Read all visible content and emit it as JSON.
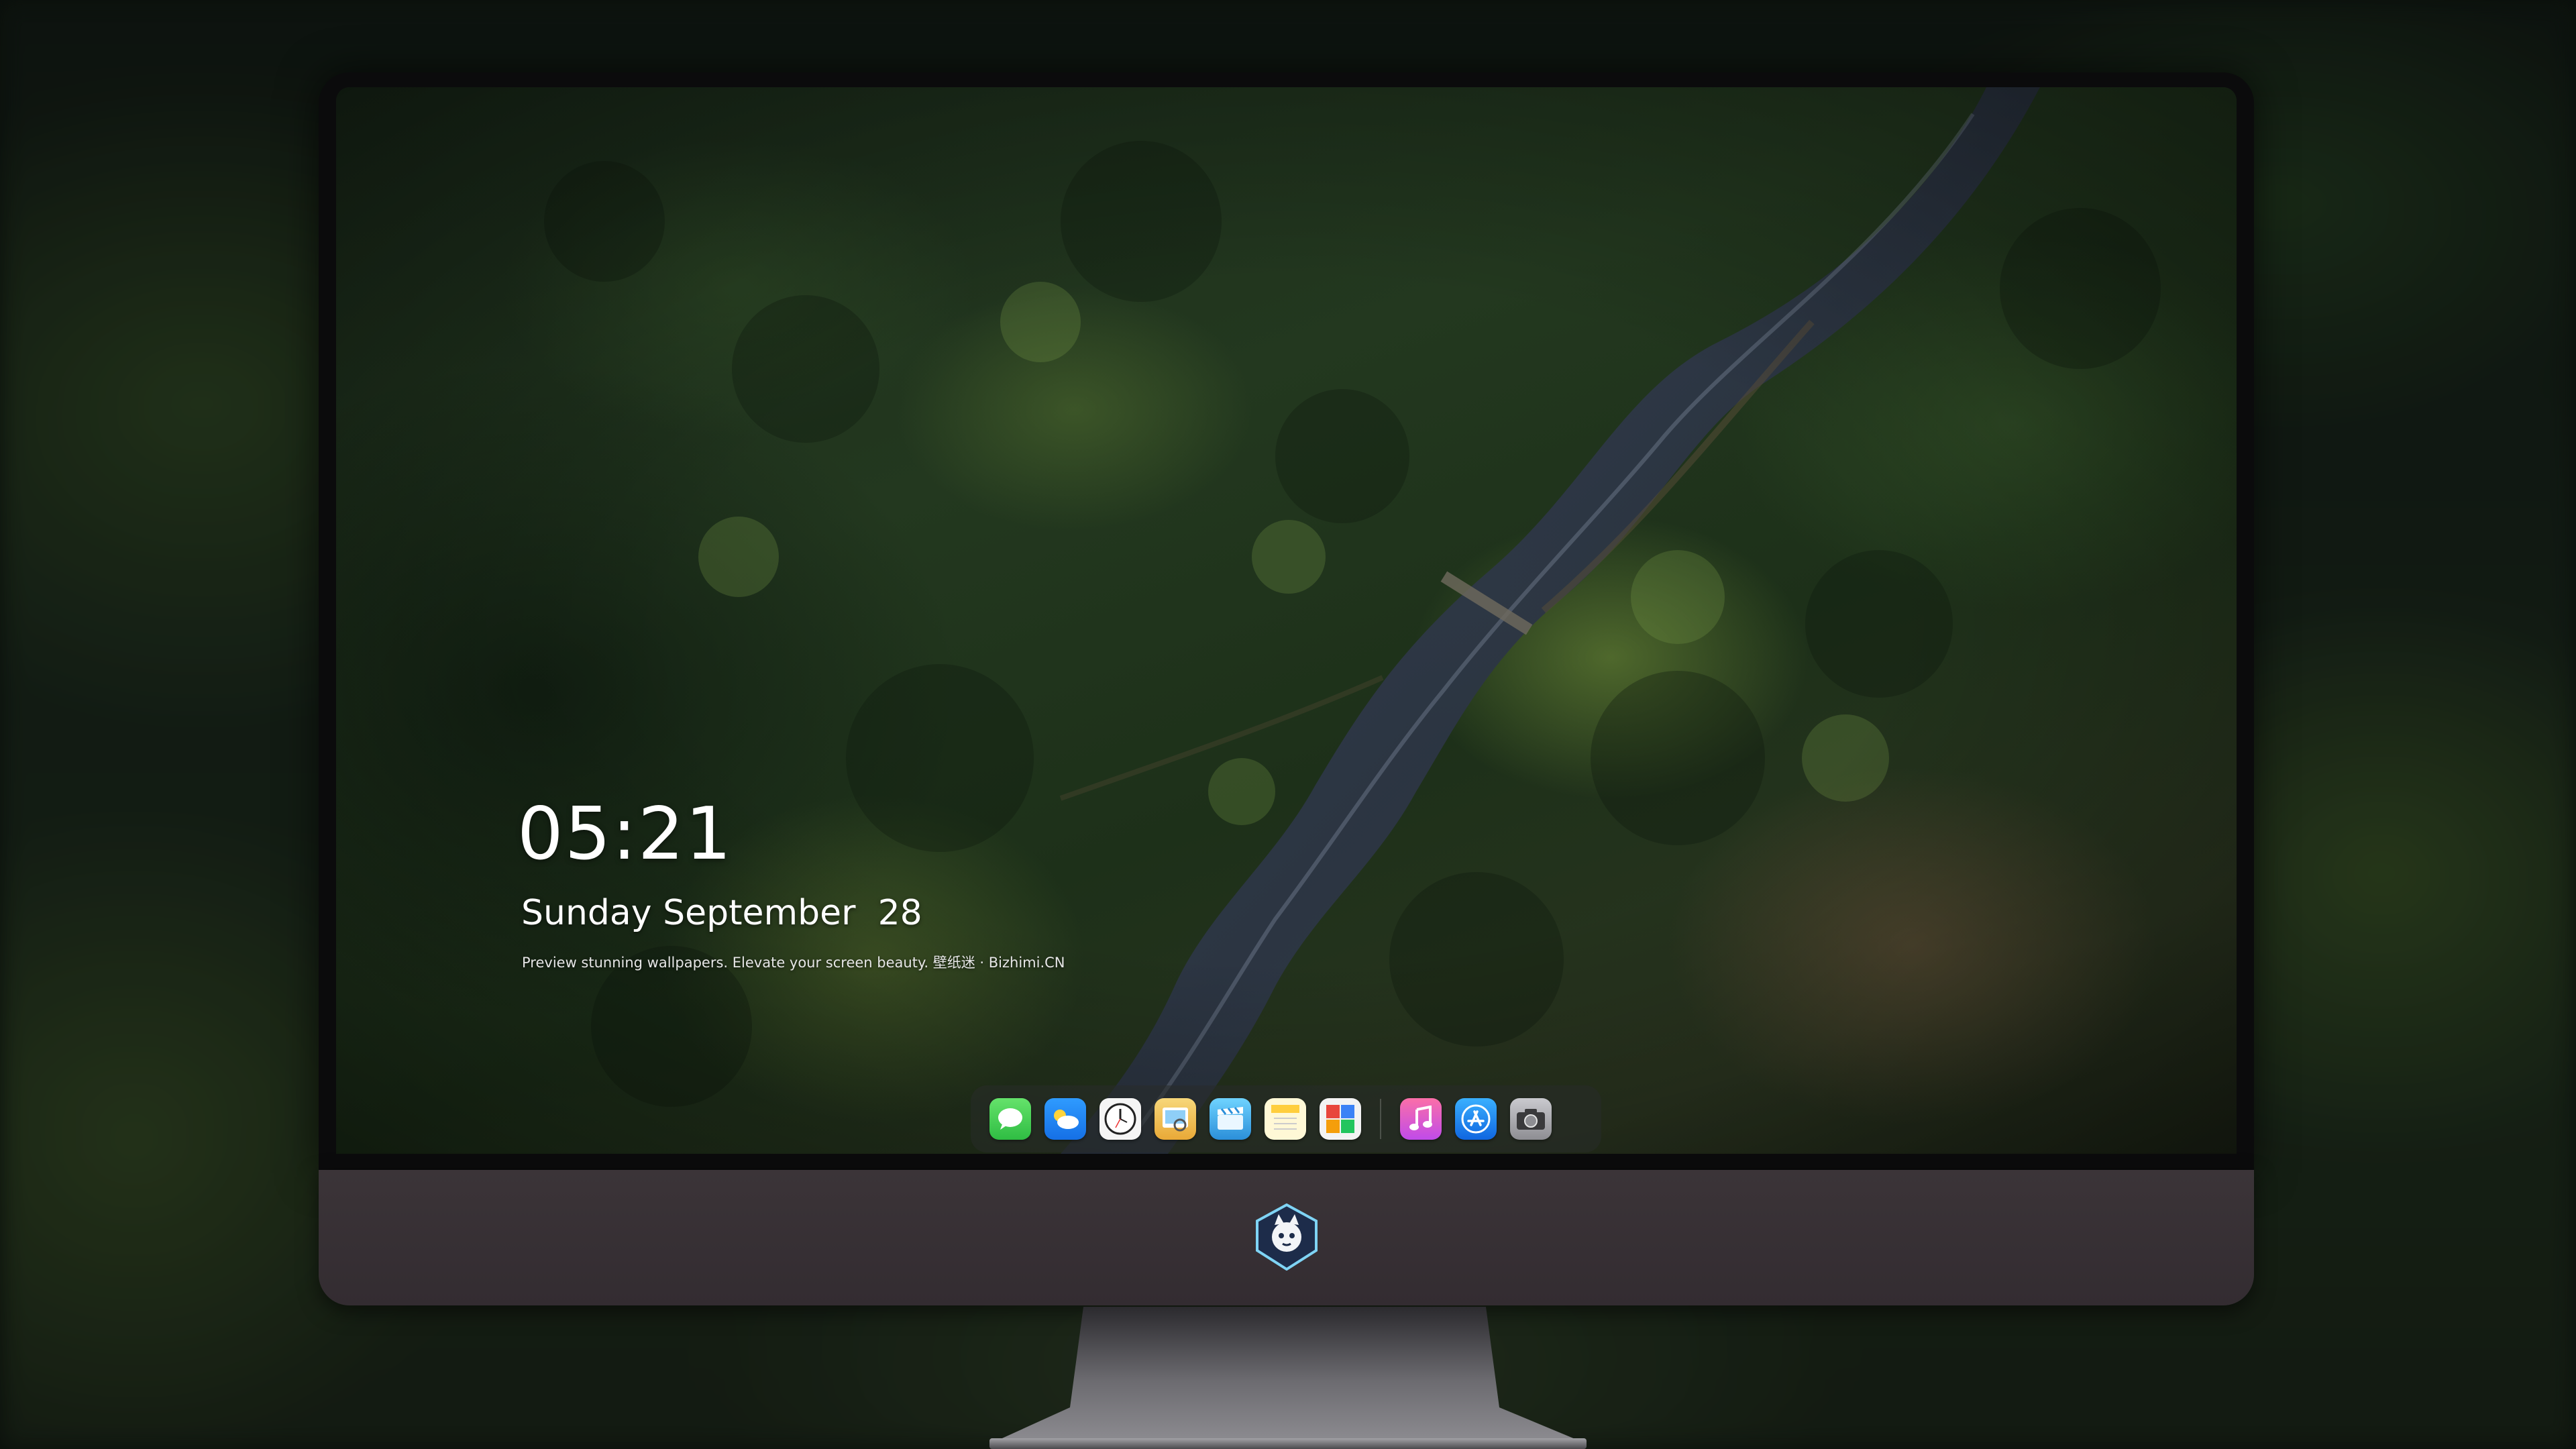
{
  "lockscreen": {
    "time": "05:21",
    "date": "Sunday September  28",
    "tagline": "Preview stunning wallpapers. Elevate your screen beauty. 壁纸迷 · Bizhimi.CN"
  },
  "dock": {
    "apps": [
      {
        "name": "messages-icon",
        "color": "#34c759"
      },
      {
        "name": "weather-icon",
        "color": "#1e8ff0"
      },
      {
        "name": "clock-icon",
        "color": "#f2f2f2"
      },
      {
        "name": "preview-icon",
        "color": "#f5c542"
      },
      {
        "name": "clips-icon",
        "color": "#5ac8fa"
      },
      {
        "name": "notes-icon",
        "color": "#ffd84d"
      },
      {
        "name": "photo-booth-icon",
        "color": "#e8463c"
      },
      {
        "name": "music-icon",
        "color": "#f5588a"
      },
      {
        "name": "app-store-icon",
        "color": "#1b8ff5"
      },
      {
        "name": "camera-icon",
        "color": "#8e8e93"
      }
    ]
  },
  "chin_logo": "mascot-logo-icon"
}
